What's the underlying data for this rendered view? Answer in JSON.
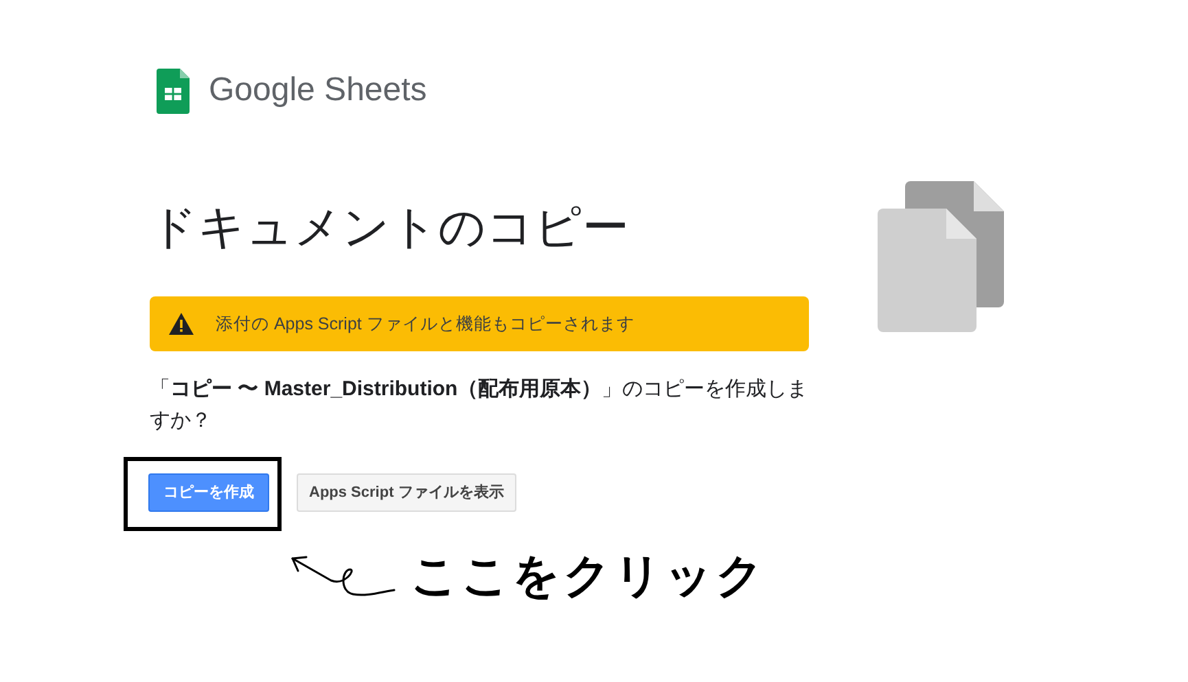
{
  "logo": {
    "text": "Google Sheets"
  },
  "heading": "ドキュメントのコピー",
  "warning": "添付の Apps Script ファイルと機能もコピーされます",
  "question": "「**コピー 〜 Master_Distribution（配布用原本）**」のコピーを作成しますか？",
  "buttons": [
    {
      "label": "コピーを作成",
      "kind": "primary"
    },
    {
      "label": "Apps Script ファイルを表示",
      "kind": "secondary"
    }
  ],
  "annotation": {
    "text": "ここをクリック"
  }
}
